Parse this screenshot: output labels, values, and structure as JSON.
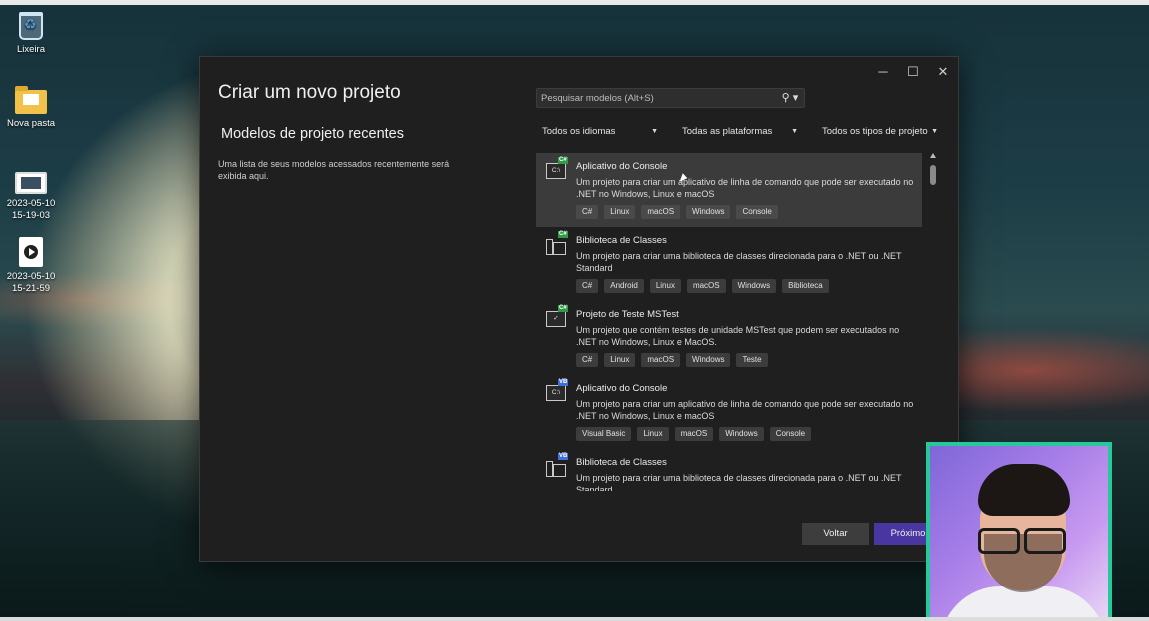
{
  "desktop": {
    "icons": [
      {
        "label": "Lixeira",
        "icon": "recycle-bin-icon"
      },
      {
        "label": "Nova pasta",
        "icon": "folder-icon"
      },
      {
        "label": "2023-05-10 15-19-03",
        "icon": "video-file-icon"
      },
      {
        "label": "2023-05-10 15-21-59",
        "icon": "video-document-icon"
      }
    ]
  },
  "dialog": {
    "window_controls": {
      "minimize": "─",
      "maximize": "☐",
      "close": "✕"
    },
    "title": "Criar um novo projeto",
    "recent": {
      "heading": "Modelos de projeto recentes",
      "description": "Uma lista de seus modelos acessados recentemente será exibida aqui."
    },
    "search": {
      "placeholder": "Pesquisar modelos (Alt+S)",
      "value": "",
      "icon": "search-icon"
    },
    "filters": {
      "language": "Todos os idiomas",
      "platform": "Todas as plataformas",
      "project_type": "Todos os tipos de projeto"
    },
    "templates": [
      {
        "name": "Aplicativo do Console",
        "lang_badge": "C#",
        "description": "Um projeto para criar um aplicativo de linha de comando que pode ser executado no .NET no Windows, Linux e macOS",
        "tags": [
          "C#",
          "Linux",
          "macOS",
          "Windows",
          "Console"
        ],
        "icon_text": "C:\\"
      },
      {
        "name": "Biblioteca de Classes",
        "lang_badge": "C#",
        "description": "Um projeto para criar uma biblioteca de classes direcionada para o .NET ou .NET Standard",
        "tags": [
          "C#",
          "Android",
          "Linux",
          "macOS",
          "Windows",
          "Biblioteca"
        ]
      },
      {
        "name": "Projeto de Teste MSTest",
        "lang_badge": "C#",
        "description": "Um projeto que contém testes de unidade MSTest que podem ser executados no .NET no Windows, Linux e MacOS.",
        "tags": [
          "C#",
          "Linux",
          "macOS",
          "Windows",
          "Teste"
        ]
      },
      {
        "name": "Aplicativo do Console",
        "lang_badge": "VB",
        "description": "Um projeto para criar um aplicativo de linha de comando que pode ser executado no .NET no Windows, Linux e macOS",
        "tags": [
          "Visual Basic",
          "Linux",
          "macOS",
          "Windows",
          "Console"
        ],
        "icon_text": "C:\\"
      },
      {
        "name": "Biblioteca de Classes",
        "lang_badge": "VB",
        "description": "Um projeto para criar uma biblioteca de classes direcionada para o .NET ou .NET Standard",
        "tags": []
      }
    ],
    "buttons": {
      "back": "Voltar",
      "next": "Próximo"
    },
    "accent_color": "#4a36a0"
  },
  "webcam": {
    "border_color": "#27c99a"
  }
}
